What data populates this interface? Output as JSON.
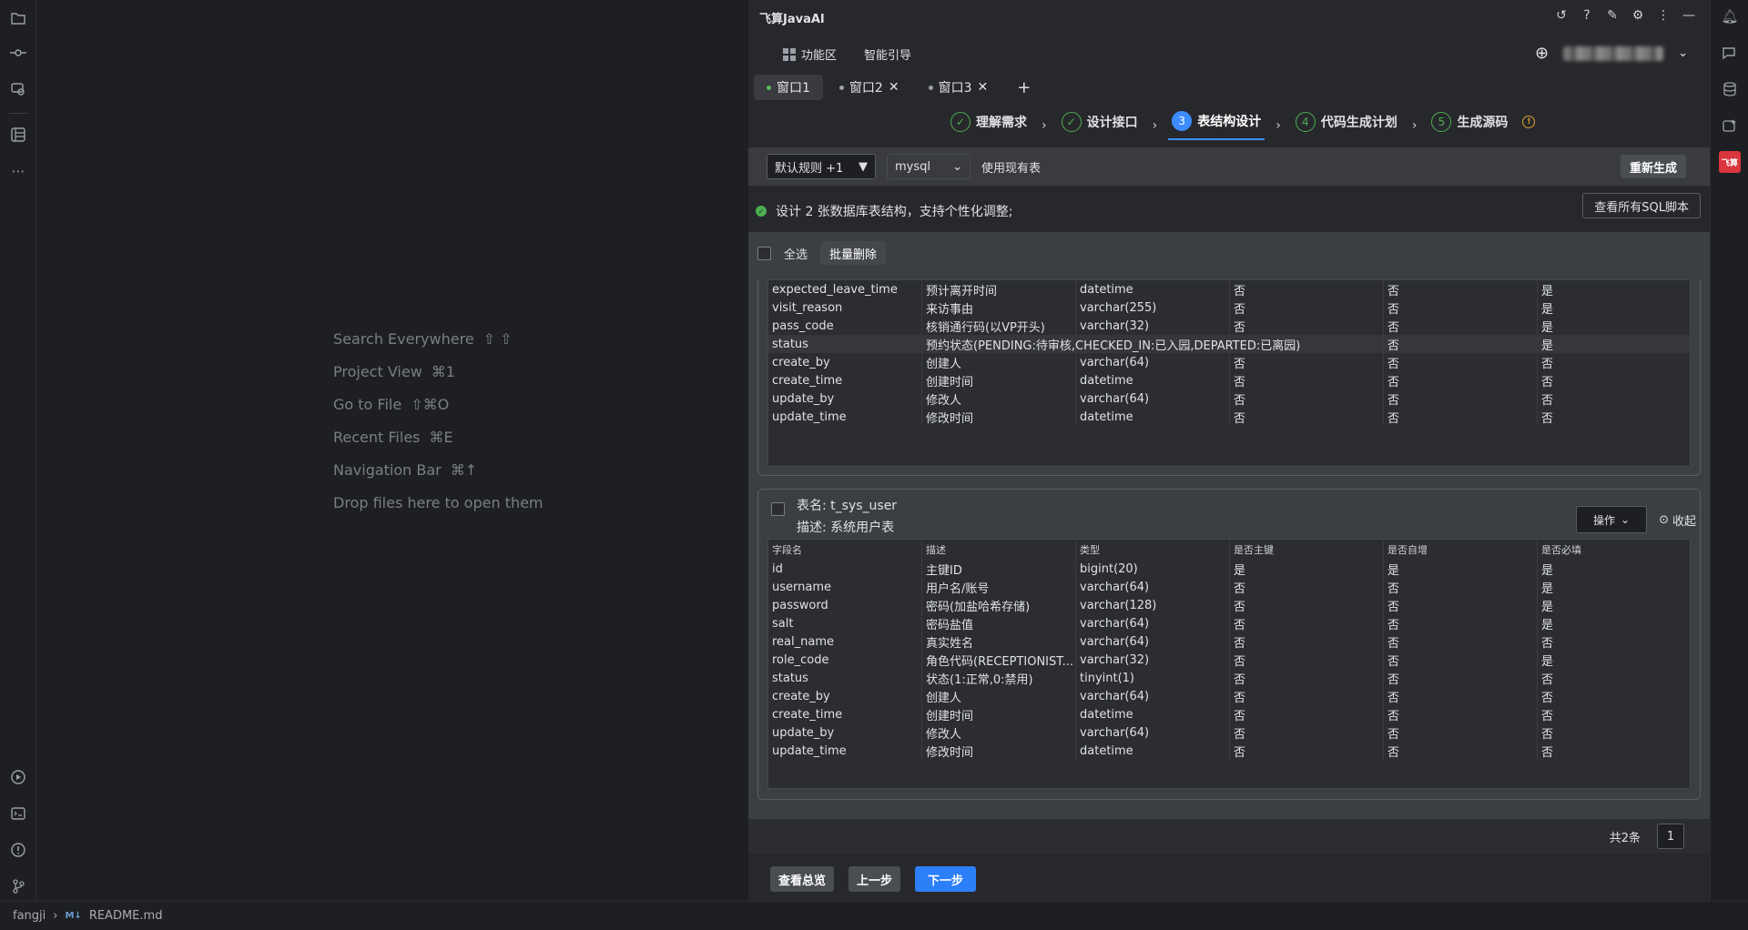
{
  "hints": [
    {
      "label": "Search Everywhere",
      "keys": "⇧ ⇧"
    },
    {
      "label": "Project View",
      "keys": "⌘1"
    },
    {
      "label": "Go to File",
      "keys": "⇧⌘O"
    },
    {
      "label": "Recent Files",
      "keys": "⌘E"
    },
    {
      "label": "Navigation Bar",
      "keys": "⌘↑"
    },
    {
      "label": "Drop files here to open them",
      "keys": ""
    }
  ],
  "plugin": {
    "title": "飞算JavaAI",
    "menu": {
      "features": "功能区",
      "guide": "智能引导"
    },
    "tabs": [
      "窗口1",
      "窗口2",
      "窗口3"
    ],
    "steps": [
      {
        "num": "✓",
        "label": "理解需求"
      },
      {
        "num": "✓",
        "label": "设计接口"
      },
      {
        "num": "3",
        "label": "表结构设计"
      },
      {
        "num": "4",
        "label": "代码生成计划"
      },
      {
        "num": "5",
        "label": "生成源码"
      }
    ],
    "controls": {
      "rules": "默认规则 +1",
      "db": "mysql",
      "use_existing": "使用现有表",
      "regenerate": "重新生成"
    },
    "info": {
      "text": "设计 2 张数据库表结构，支持个性化调整;",
      "view_sql": "查看所有SQL脚本"
    },
    "select_all": "全选",
    "batch_delete": "批量删除",
    "table1_rows": [
      [
        "expected_leave_time",
        "预计离开时间",
        "datetime",
        "否",
        "否",
        "是"
      ],
      [
        "visit_reason",
        "来访事由",
        "varchar(255)",
        "否",
        "否",
        "是"
      ],
      [
        "pass_code",
        "核销通行码(以VP开头)",
        "varchar(32)",
        "否",
        "否",
        "是"
      ],
      [
        "status",
        "预约状态(PENDING:待审核,CHECKED_IN:已入园,DEPARTED:已离园)",
        "",
        "",
        "否",
        "是"
      ],
      [
        "create_by",
        "创建人",
        "varchar(64)",
        "否",
        "否",
        "否"
      ],
      [
        "create_time",
        "创建时间",
        "datetime",
        "否",
        "否",
        "否"
      ],
      [
        "update_by",
        "修改人",
        "varchar(64)",
        "否",
        "否",
        "否"
      ],
      [
        "update_time",
        "修改时间",
        "datetime",
        "否",
        "否",
        "否"
      ]
    ],
    "table2": {
      "name_label": "表名: t_sys_user",
      "desc_label": "描述: 系统用户表",
      "op": "操作",
      "collapse": "收起",
      "headers": [
        "字段名",
        "描述",
        "类型",
        "是否主键",
        "是否自增",
        "是否必填"
      ],
      "rows": [
        [
          "id",
          "主键ID",
          "bigint(20)",
          "是",
          "是",
          "是"
        ],
        [
          "username",
          "用户名/账号",
          "varchar(64)",
          "否",
          "否",
          "是"
        ],
        [
          "password",
          "密码(加盐哈希存储)",
          "varchar(128)",
          "否",
          "否",
          "是"
        ],
        [
          "salt",
          "密码盐值",
          "varchar(64)",
          "否",
          "否",
          "是"
        ],
        [
          "real_name",
          "真实姓名",
          "varchar(64)",
          "否",
          "否",
          "否"
        ],
        [
          "role_code",
          "角色代码(RECEPTIONIST...",
          "varchar(32)",
          "否",
          "否",
          "是"
        ],
        [
          "status",
          "状态(1:正常,0:禁用)",
          "tinyint(1)",
          "否",
          "否",
          "否"
        ],
        [
          "create_by",
          "创建人",
          "varchar(64)",
          "否",
          "否",
          "否"
        ],
        [
          "create_time",
          "创建时间",
          "datetime",
          "否",
          "否",
          "否"
        ],
        [
          "update_by",
          "修改人",
          "varchar(64)",
          "否",
          "否",
          "否"
        ],
        [
          "update_time",
          "修改时间",
          "datetime",
          "否",
          "否",
          "否"
        ]
      ]
    },
    "footer": {
      "total": "共2条",
      "page": "1"
    },
    "nav": {
      "overview": "查看总览",
      "prev": "上一步",
      "next": "下一步"
    }
  },
  "status": {
    "project": "fangji",
    "file": "README.md",
    "file_badge": "M↓"
  },
  "colors": {
    "accent": "#2d7ff9",
    "success": "#4caf50",
    "brand_red": "#d9363e"
  }
}
